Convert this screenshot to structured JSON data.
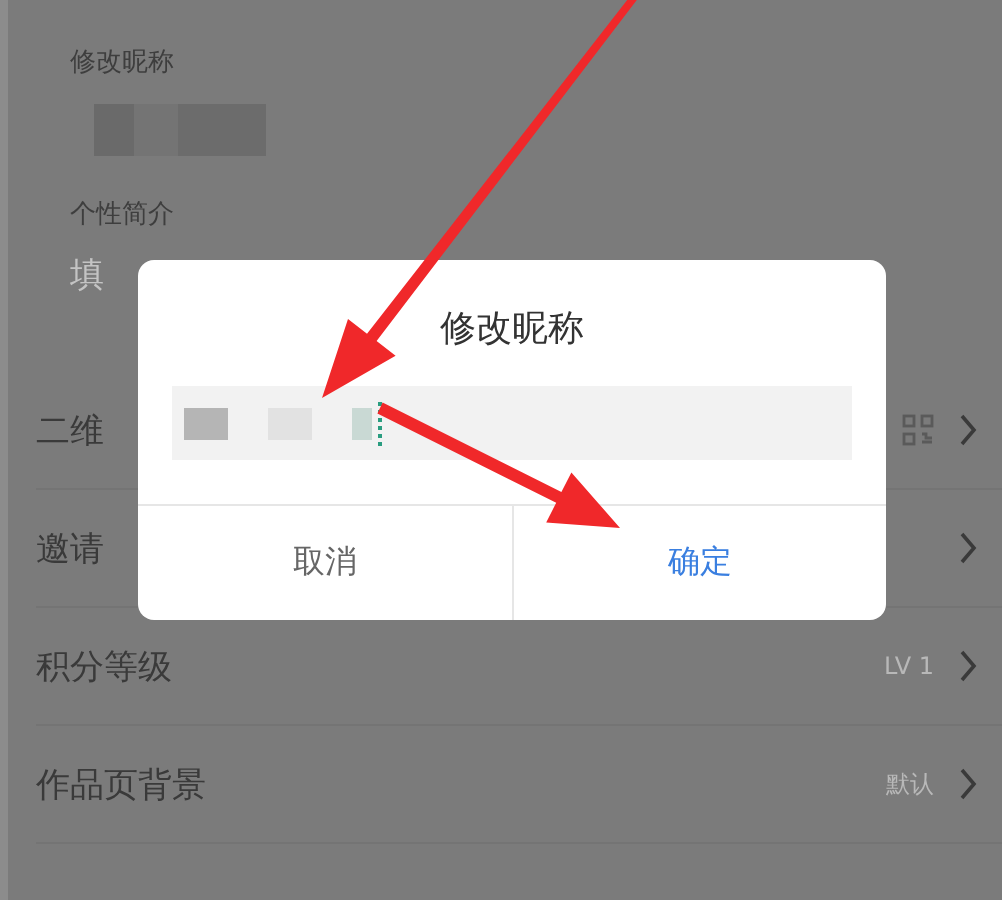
{
  "profile": {
    "nickname_label": "修改昵称",
    "bio_label": "个性简介",
    "bio_placeholder": "填"
  },
  "rows": [
    {
      "label": "二维",
      "kind": "qr"
    },
    {
      "label": "邀请",
      "kind": "plain"
    },
    {
      "label": "积分等级",
      "kind": "value",
      "value": "LV 1"
    },
    {
      "label": "作品页背景",
      "kind": "value",
      "value": "默认"
    }
  ],
  "dialog": {
    "title": "修改昵称",
    "buttons": [
      {
        "label": "取消",
        "kind": "cancel"
      },
      {
        "label": "确定",
        "kind": "confirm"
      }
    ]
  }
}
